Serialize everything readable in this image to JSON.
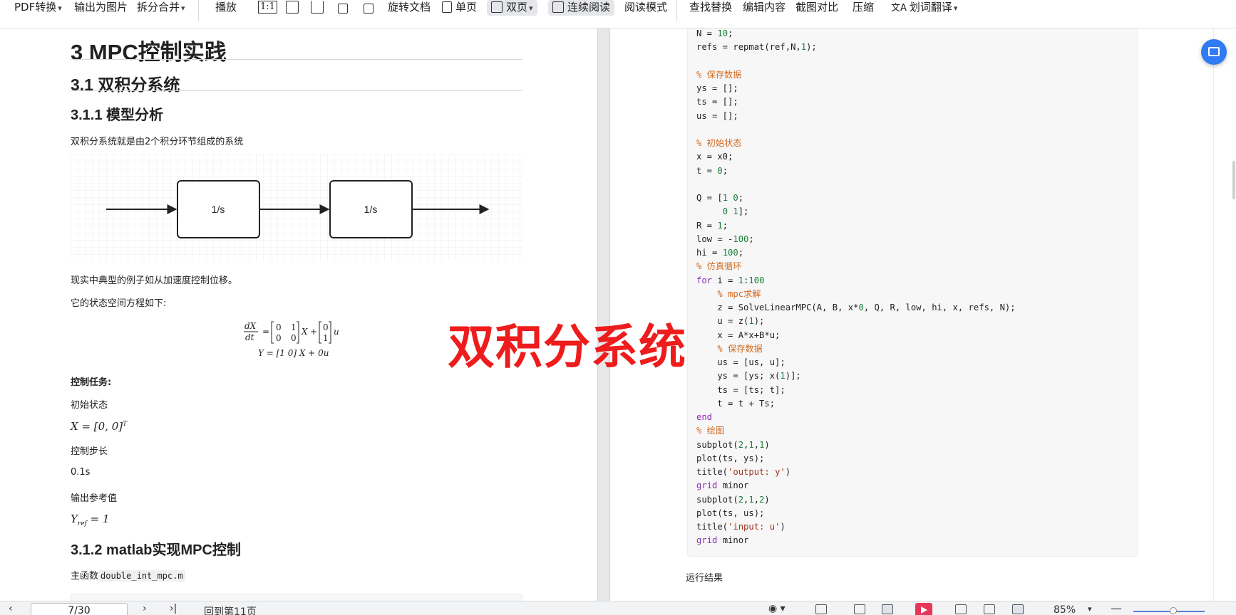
{
  "toolbar": {
    "pdf_convert": "PDF转换",
    "export_image": "输出为图片",
    "split_merge": "拆分合并",
    "play": "播放",
    "actual_size": "1:1",
    "rotate_doc": "旋转文档",
    "single_page": "单页",
    "double_page": "双页",
    "continuous_read": "连续阅读",
    "read_mode": "阅读模式",
    "find_replace": "查找替换",
    "edit_content": "编辑内容",
    "screenshot_compare": "截图对比",
    "compress": "压缩",
    "word_translate": "划词翻译"
  },
  "doc": {
    "h1": "3 MPC控制实践",
    "h2": "3.1 双积分系统",
    "h3_model": "3.1.1 模型分析",
    "intro": "双积分系统就是由2个积分环节组成的系统",
    "block1": "1/s",
    "block2": "1/s",
    "example": "现实中典型的例子如从加速度控制位移。",
    "state_space_intro": "它的状态空间方程如下:",
    "eq_lhs": "dX/dt",
    "eq_line2": "Y = [1  0] X + 0u",
    "control_task": "控制任务:",
    "init_state_label": "初始状态",
    "init_state_math": "X = [0, 0]",
    "init_state_sup": "T",
    "step_label": "控制步长",
    "step_value": "0.1s",
    "ref_label": "输出参考值",
    "ref_math": "Y",
    "ref_sub": "ref",
    "ref_value": " = 1",
    "h3_matlab": "3.1.2 matlab实现MPC控制",
    "main_func_label": "主函数",
    "main_func_file": "double_int_mpc.m",
    "run_result": "运行结果"
  },
  "code_lines": [
    [
      {
        "t": "N = "
      },
      {
        "t": "10",
        "c": "n"
      },
      {
        "t": ";"
      }
    ],
    [
      {
        "t": "refs = repmat(ref,N,"
      },
      {
        "t": "1",
        "c": "n"
      },
      {
        "t": ");"
      }
    ],
    [
      {
        "t": ""
      }
    ],
    [
      {
        "t": "% 保存数据",
        "c": "c"
      }
    ],
    [
      {
        "t": "ys = [];"
      }
    ],
    [
      {
        "t": "ts = [];"
      }
    ],
    [
      {
        "t": "us = [];"
      }
    ],
    [
      {
        "t": ""
      }
    ],
    [
      {
        "t": "% 初始状态",
        "c": "c"
      }
    ],
    [
      {
        "t": "x = x0;"
      }
    ],
    [
      {
        "t": "t = "
      },
      {
        "t": "0",
        "c": "n"
      },
      {
        "t": ";"
      }
    ],
    [
      {
        "t": ""
      }
    ],
    [
      {
        "t": "Q = ["
      },
      {
        "t": "1 0",
        "c": "n"
      },
      {
        "t": ";"
      }
    ],
    [
      {
        "t": "     "
      },
      {
        "t": "0 1",
        "c": "n"
      },
      {
        "t": "];"
      }
    ],
    [
      {
        "t": "R = "
      },
      {
        "t": "1",
        "c": "n"
      },
      {
        "t": ";"
      }
    ],
    [
      {
        "t": "low = -"
      },
      {
        "t": "100",
        "c": "n"
      },
      {
        "t": ";"
      }
    ],
    [
      {
        "t": "hi = "
      },
      {
        "t": "100",
        "c": "n"
      },
      {
        "t": ";"
      }
    ],
    [
      {
        "t": "% 仿真循环",
        "c": "c"
      }
    ],
    [
      {
        "t": "for",
        "c": "k"
      },
      {
        "t": " i = "
      },
      {
        "t": "1",
        "c": "n"
      },
      {
        "t": ":"
      },
      {
        "t": "100",
        "c": "n"
      }
    ],
    [
      {
        "t": "    "
      },
      {
        "t": "% mpc求解",
        "c": "c"
      }
    ],
    [
      {
        "t": "    z = SolveLinearMPC(A, B, x*"
      },
      {
        "t": "0",
        "c": "n"
      },
      {
        "t": ", Q, R, low, hi, x, refs, N);"
      }
    ],
    [
      {
        "t": "    u = z("
      },
      {
        "t": "1",
        "c": "n"
      },
      {
        "t": ");"
      }
    ],
    [
      {
        "t": "    x = A*x+B*u;"
      }
    ],
    [
      {
        "t": "    "
      },
      {
        "t": "% 保存数据",
        "c": "c"
      }
    ],
    [
      {
        "t": "    us = [us, u];"
      }
    ],
    [
      {
        "t": "    ys = [ys; x("
      },
      {
        "t": "1",
        "c": "n"
      },
      {
        "t": ")];"
      }
    ],
    [
      {
        "t": "    ts = [ts; t];"
      }
    ],
    [
      {
        "t": "    t = t + Ts;"
      }
    ],
    [
      {
        "t": "end",
        "c": "k"
      }
    ],
    [
      {
        "t": "% 绘图",
        "c": "c"
      }
    ],
    [
      {
        "t": "subplot("
      },
      {
        "t": "2",
        "c": "n"
      },
      {
        "t": ","
      },
      {
        "t": "1",
        "c": "n"
      },
      {
        "t": ","
      },
      {
        "t": "1",
        "c": "n"
      },
      {
        "t": ")"
      }
    ],
    [
      {
        "t": "plot(ts, ys);"
      }
    ],
    [
      {
        "t": "title("
      },
      {
        "t": "'output: y'",
        "c": "s"
      },
      {
        "t": ")"
      }
    ],
    [
      {
        "t": "grid",
        "c": "k"
      },
      {
        "t": " minor"
      }
    ],
    [
      {
        "t": "subplot("
      },
      {
        "t": "2",
        "c": "n"
      },
      {
        "t": ","
      },
      {
        "t": "1",
        "c": "n"
      },
      {
        "t": ","
      },
      {
        "t": "2",
        "c": "n"
      },
      {
        "t": ")"
      }
    ],
    [
      {
        "t": "plot(ts, us);"
      }
    ],
    [
      {
        "t": "title("
      },
      {
        "t": "'input: u'",
        "c": "s"
      },
      {
        "t": ")"
      }
    ],
    [
      {
        "t": "grid",
        "c": "k"
      },
      {
        "t": " minor"
      }
    ]
  ],
  "watermark": "双积分系统",
  "statusbar": {
    "page_value": "7/30",
    "back_to_page": "回到第11页",
    "zoom": "85%"
  }
}
